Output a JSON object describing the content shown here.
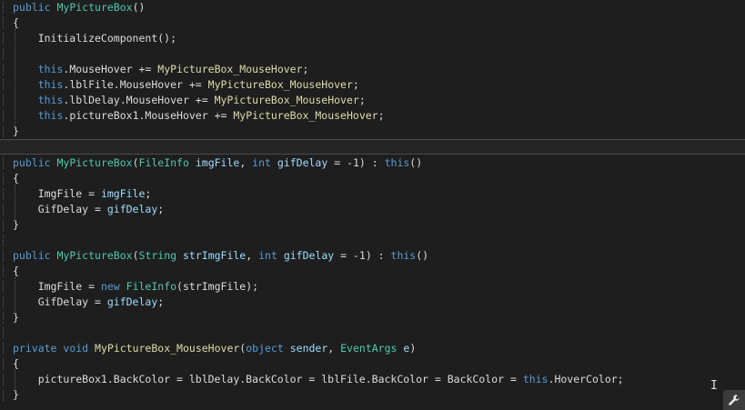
{
  "editor": {
    "top_pane": {
      "lines": [
        [
          {
            "t": "public",
            "c": "kw"
          },
          {
            "t": " "
          },
          {
            "t": "MyPictureBox",
            "c": "ty"
          },
          {
            "t": "()",
            "c": "pl"
          }
        ],
        [
          {
            "t": "{",
            "c": "pl"
          }
        ],
        [
          {
            "t": "    InitializeComponent();",
            "c": "pl"
          }
        ],
        [],
        [
          {
            "t": "    "
          },
          {
            "t": "this",
            "c": "kw"
          },
          {
            "t": ".MouseHover += ",
            "c": "pl"
          },
          {
            "t": "MyPictureBox_MouseHover",
            "c": "me"
          },
          {
            "t": ";",
            "c": "pl"
          }
        ],
        [
          {
            "t": "    "
          },
          {
            "t": "this",
            "c": "kw"
          },
          {
            "t": ".lblFile.MouseHover += ",
            "c": "pl"
          },
          {
            "t": "MyPictureBox_MouseHover",
            "c": "me"
          },
          {
            "t": ";",
            "c": "pl"
          }
        ],
        [
          {
            "t": "    "
          },
          {
            "t": "this",
            "c": "kw"
          },
          {
            "t": ".lblDelay.MouseHover += ",
            "c": "pl"
          },
          {
            "t": "MyPictureBox_MouseHover",
            "c": "me"
          },
          {
            "t": ";",
            "c": "pl"
          }
        ],
        [
          {
            "t": "    "
          },
          {
            "t": "this",
            "c": "kw"
          },
          {
            "t": ".pictureBox1.MouseHover += ",
            "c": "pl"
          },
          {
            "t": "MyPictureBox_MouseHover",
            "c": "me"
          },
          {
            "t": ";",
            "c": "pl"
          }
        ],
        [
          {
            "t": "}",
            "c": "pl"
          }
        ]
      ]
    },
    "bottom_pane": {
      "lines": [
        [
          {
            "t": "public",
            "c": "kw"
          },
          {
            "t": " "
          },
          {
            "t": "MyPictureBox",
            "c": "ty"
          },
          {
            "t": "(",
            "c": "pl"
          },
          {
            "t": "FileInfo",
            "c": "ty"
          },
          {
            "t": " "
          },
          {
            "t": "imgFile",
            "c": "pa"
          },
          {
            "t": ", ",
            "c": "pl"
          },
          {
            "t": "int",
            "c": "kw"
          },
          {
            "t": " "
          },
          {
            "t": "gifDelay",
            "c": "pa"
          },
          {
            "t": " = -1) : ",
            "c": "pl"
          },
          {
            "t": "this",
            "c": "kw"
          },
          {
            "t": "()",
            "c": "pl"
          }
        ],
        [
          {
            "t": "{",
            "c": "pl"
          }
        ],
        [
          {
            "t": "    ImgFile = ",
            "c": "pl"
          },
          {
            "t": "imgFile",
            "c": "pa"
          },
          {
            "t": ";",
            "c": "pl"
          }
        ],
        [
          {
            "t": "    GifDelay = ",
            "c": "pl"
          },
          {
            "t": "gifDelay",
            "c": "pa"
          },
          {
            "t": ";",
            "c": "pl"
          }
        ],
        [
          {
            "t": "}",
            "c": "pl"
          }
        ],
        [],
        [
          {
            "t": "public",
            "c": "kw"
          },
          {
            "t": " "
          },
          {
            "t": "MyPictureBox",
            "c": "ty"
          },
          {
            "t": "(",
            "c": "pl"
          },
          {
            "t": "String",
            "c": "ty"
          },
          {
            "t": " "
          },
          {
            "t": "strImgFile",
            "c": "pa"
          },
          {
            "t": ", ",
            "c": "pl"
          },
          {
            "t": "int",
            "c": "kw"
          },
          {
            "t": " "
          },
          {
            "t": "gifDelay",
            "c": "pa"
          },
          {
            "t": " = -1) : ",
            "c": "pl"
          },
          {
            "t": "this",
            "c": "kw"
          },
          {
            "t": "()",
            "c": "pl"
          }
        ],
        [
          {
            "t": "{",
            "c": "pl"
          }
        ],
        [
          {
            "t": "    ImgFile = ",
            "c": "pl"
          },
          {
            "t": "new",
            "c": "kw"
          },
          {
            "t": " "
          },
          {
            "t": "FileInfo",
            "c": "ty"
          },
          {
            "t": "(strImgFile);",
            "c": "pl"
          }
        ],
        [
          {
            "t": "    GifDelay = ",
            "c": "pl"
          },
          {
            "t": "gifDelay",
            "c": "pa"
          },
          {
            "t": ";",
            "c": "pl"
          }
        ],
        [
          {
            "t": "}",
            "c": "pl"
          }
        ],
        [],
        [
          {
            "t": "private",
            "c": "kw"
          },
          {
            "t": " "
          },
          {
            "t": "void",
            "c": "kw"
          },
          {
            "t": " "
          },
          {
            "t": "MyPictureBox_MouseHover",
            "c": "me"
          },
          {
            "t": "(",
            "c": "pl"
          },
          {
            "t": "object",
            "c": "kw"
          },
          {
            "t": " "
          },
          {
            "t": "sender",
            "c": "pa"
          },
          {
            "t": ", ",
            "c": "pl"
          },
          {
            "t": "EventArgs",
            "c": "ty"
          },
          {
            "t": " "
          },
          {
            "t": "e",
            "c": "pa"
          },
          {
            "t": ")",
            "c": "pl"
          }
        ],
        [
          {
            "t": "{",
            "c": "pl"
          }
        ],
        [
          {
            "t": "    pictureBox1.BackColor = lblDelay.BackColor = lblFile.BackColor = BackColor = ",
            "c": "pl"
          },
          {
            "t": "this",
            "c": "kw"
          },
          {
            "t": ".HoverColor;",
            "c": "pl"
          }
        ],
        [
          {
            "t": "}",
            "c": "pl"
          }
        ]
      ]
    },
    "colors": {
      "keyword": "#569cd6",
      "type": "#4ec9b0",
      "method": "#dcdcaa",
      "parameter": "#9cdcfe",
      "plain": "#dcdcdc",
      "background": "#1e1e1e"
    },
    "corner_icon": "wrench-icon"
  }
}
